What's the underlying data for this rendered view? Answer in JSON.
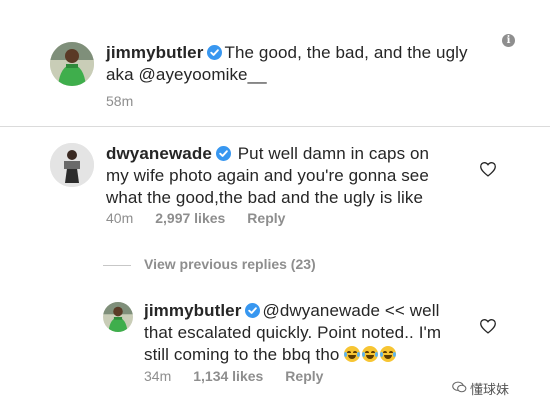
{
  "comments": [
    {
      "username": "jimmybutler",
      "text_before_mention": "The good, the bad, and the ugly aka ",
      "mention": "@ayeyoomike__",
      "time": "58m"
    },
    {
      "username": "dwyanewade",
      "text": "Put well damn in caps on my wife photo again and you're gonna see what the good,the bad and the ugly is like",
      "time": "40m",
      "likes": "2,997 likes",
      "reply_label": "Reply"
    }
  ],
  "view_replies_label": "View previous replies (23)",
  "reply": {
    "username": "jimmybutler",
    "mention": "@dwyanewade",
    "text": " << well that escalated quickly. Point noted.. I'm still coming to the bbq tho ",
    "emoji_count": 3,
    "time": "34m",
    "likes": "1,134 likes",
    "reply_label": "Reply"
  },
  "icons": {
    "info": "info-icon",
    "heart": "heart-outline-icon",
    "verified": "verified-badge-icon",
    "emoji": "laughing-tears-emoji"
  },
  "watermark": "懂球妹",
  "colors": {
    "verified_blue": "#3897f0",
    "muted_gray": "#8e8e8e"
  }
}
